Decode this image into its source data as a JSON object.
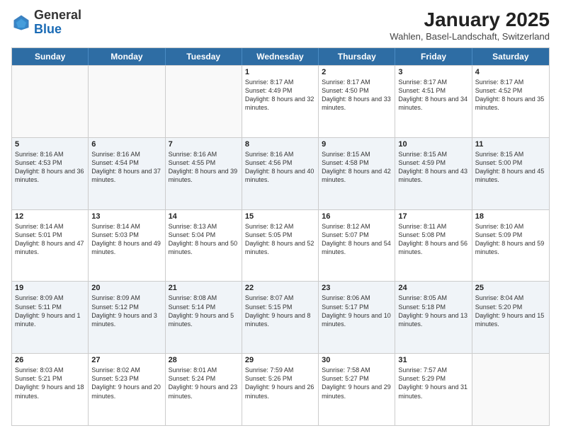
{
  "header": {
    "logo_general": "General",
    "logo_blue": "Blue",
    "month_year": "January 2025",
    "location": "Wahlen, Basel-Landschaft, Switzerland"
  },
  "calendar": {
    "days_of_week": [
      "Sunday",
      "Monday",
      "Tuesday",
      "Wednesday",
      "Thursday",
      "Friday",
      "Saturday"
    ],
    "weeks": [
      {
        "alt": false,
        "cells": [
          {
            "day": "",
            "info": ""
          },
          {
            "day": "",
            "info": ""
          },
          {
            "day": "",
            "info": ""
          },
          {
            "day": "1",
            "info": "Sunrise: 8:17 AM\nSunset: 4:49 PM\nDaylight: 8 hours and 32 minutes."
          },
          {
            "day": "2",
            "info": "Sunrise: 8:17 AM\nSunset: 4:50 PM\nDaylight: 8 hours and 33 minutes."
          },
          {
            "day": "3",
            "info": "Sunrise: 8:17 AM\nSunset: 4:51 PM\nDaylight: 8 hours and 34 minutes."
          },
          {
            "day": "4",
            "info": "Sunrise: 8:17 AM\nSunset: 4:52 PM\nDaylight: 8 hours and 35 minutes."
          }
        ]
      },
      {
        "alt": true,
        "cells": [
          {
            "day": "5",
            "info": "Sunrise: 8:16 AM\nSunset: 4:53 PM\nDaylight: 8 hours and 36 minutes."
          },
          {
            "day": "6",
            "info": "Sunrise: 8:16 AM\nSunset: 4:54 PM\nDaylight: 8 hours and 37 minutes."
          },
          {
            "day": "7",
            "info": "Sunrise: 8:16 AM\nSunset: 4:55 PM\nDaylight: 8 hours and 39 minutes."
          },
          {
            "day": "8",
            "info": "Sunrise: 8:16 AM\nSunset: 4:56 PM\nDaylight: 8 hours and 40 minutes."
          },
          {
            "day": "9",
            "info": "Sunrise: 8:15 AM\nSunset: 4:58 PM\nDaylight: 8 hours and 42 minutes."
          },
          {
            "day": "10",
            "info": "Sunrise: 8:15 AM\nSunset: 4:59 PM\nDaylight: 8 hours and 43 minutes."
          },
          {
            "day": "11",
            "info": "Sunrise: 8:15 AM\nSunset: 5:00 PM\nDaylight: 8 hours and 45 minutes."
          }
        ]
      },
      {
        "alt": false,
        "cells": [
          {
            "day": "12",
            "info": "Sunrise: 8:14 AM\nSunset: 5:01 PM\nDaylight: 8 hours and 47 minutes."
          },
          {
            "day": "13",
            "info": "Sunrise: 8:14 AM\nSunset: 5:03 PM\nDaylight: 8 hours and 49 minutes."
          },
          {
            "day": "14",
            "info": "Sunrise: 8:13 AM\nSunset: 5:04 PM\nDaylight: 8 hours and 50 minutes."
          },
          {
            "day": "15",
            "info": "Sunrise: 8:12 AM\nSunset: 5:05 PM\nDaylight: 8 hours and 52 minutes."
          },
          {
            "day": "16",
            "info": "Sunrise: 8:12 AM\nSunset: 5:07 PM\nDaylight: 8 hours and 54 minutes."
          },
          {
            "day": "17",
            "info": "Sunrise: 8:11 AM\nSunset: 5:08 PM\nDaylight: 8 hours and 56 minutes."
          },
          {
            "day": "18",
            "info": "Sunrise: 8:10 AM\nSunset: 5:09 PM\nDaylight: 8 hours and 59 minutes."
          }
        ]
      },
      {
        "alt": true,
        "cells": [
          {
            "day": "19",
            "info": "Sunrise: 8:09 AM\nSunset: 5:11 PM\nDaylight: 9 hours and 1 minute."
          },
          {
            "day": "20",
            "info": "Sunrise: 8:09 AM\nSunset: 5:12 PM\nDaylight: 9 hours and 3 minutes."
          },
          {
            "day": "21",
            "info": "Sunrise: 8:08 AM\nSunset: 5:14 PM\nDaylight: 9 hours and 5 minutes."
          },
          {
            "day": "22",
            "info": "Sunrise: 8:07 AM\nSunset: 5:15 PM\nDaylight: 9 hours and 8 minutes."
          },
          {
            "day": "23",
            "info": "Sunrise: 8:06 AM\nSunset: 5:17 PM\nDaylight: 9 hours and 10 minutes."
          },
          {
            "day": "24",
            "info": "Sunrise: 8:05 AM\nSunset: 5:18 PM\nDaylight: 9 hours and 13 minutes."
          },
          {
            "day": "25",
            "info": "Sunrise: 8:04 AM\nSunset: 5:20 PM\nDaylight: 9 hours and 15 minutes."
          }
        ]
      },
      {
        "alt": false,
        "cells": [
          {
            "day": "26",
            "info": "Sunrise: 8:03 AM\nSunset: 5:21 PM\nDaylight: 9 hours and 18 minutes."
          },
          {
            "day": "27",
            "info": "Sunrise: 8:02 AM\nSunset: 5:23 PM\nDaylight: 9 hours and 20 minutes."
          },
          {
            "day": "28",
            "info": "Sunrise: 8:01 AM\nSunset: 5:24 PM\nDaylight: 9 hours and 23 minutes."
          },
          {
            "day": "29",
            "info": "Sunrise: 7:59 AM\nSunset: 5:26 PM\nDaylight: 9 hours and 26 minutes."
          },
          {
            "day": "30",
            "info": "Sunrise: 7:58 AM\nSunset: 5:27 PM\nDaylight: 9 hours and 29 minutes."
          },
          {
            "day": "31",
            "info": "Sunrise: 7:57 AM\nSunset: 5:29 PM\nDaylight: 9 hours and 31 minutes."
          },
          {
            "day": "",
            "info": ""
          }
        ]
      }
    ]
  }
}
